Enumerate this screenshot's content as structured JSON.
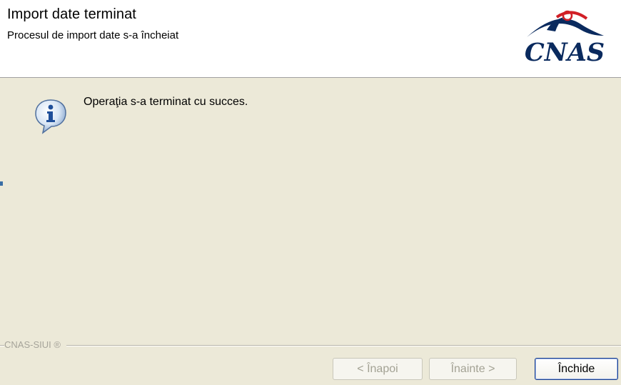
{
  "header": {
    "title": "Import date terminat",
    "subtitle": "Procesul de import date s-a încheiat",
    "logo_text": "CNAS"
  },
  "main": {
    "message": "Operaţia s-a terminat cu succes."
  },
  "footer": {
    "label": "CNAS-SIUI ®"
  },
  "buttons": {
    "back": "< Înapoi",
    "next": "Înainte >",
    "close": "Închide"
  },
  "icons": {
    "info": "info-icon",
    "logo": "cnas-logo"
  },
  "colors": {
    "dialog_bg": "#ece9d8",
    "header_bg": "#ffffff",
    "logo_blue": "#0a2a5e",
    "logo_red": "#d11f26"
  }
}
